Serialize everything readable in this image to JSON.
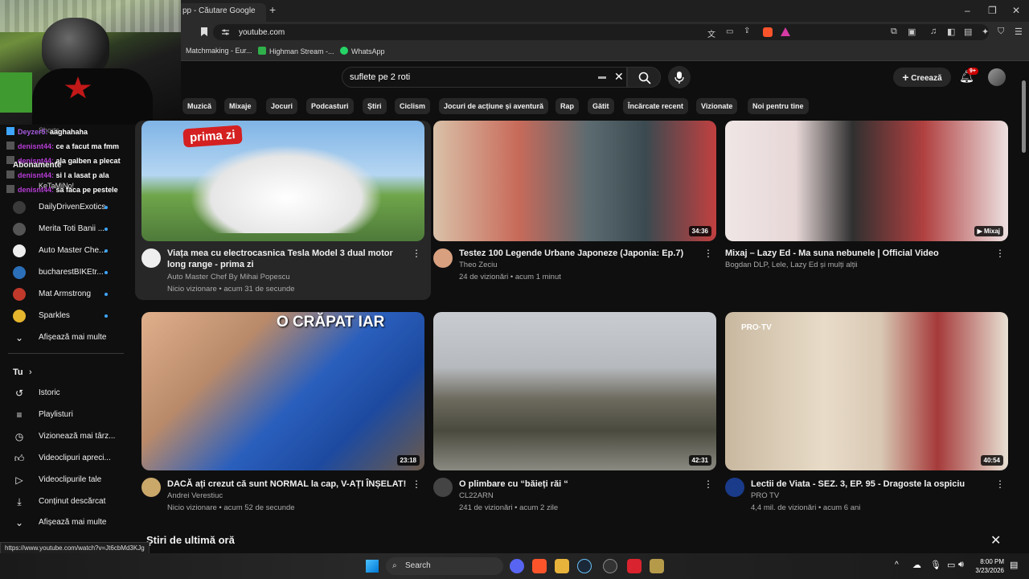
{
  "browser": {
    "tab_title": "pp - Căutare Google",
    "new_tab": "+",
    "url": "youtube.com",
    "bookmarks": [
      "Matchmaking - Eur...",
      "Highman Stream -...",
      "WhatsApp"
    ],
    "window_controls": [
      "–",
      "❐",
      "✕"
    ]
  },
  "youtube": {
    "search_query": "suflete pe 2 roti",
    "create_label": "Creează",
    "notif_badge": "9+",
    "chips": [
      "Muzică",
      "Mixaje",
      "Jocuri",
      "Podcasturi",
      "Știri",
      "Ciclism",
      "Jocuri de acțiune și aventură",
      "Rap",
      "Gătit",
      "Încărcate recent",
      "Vizionate",
      "Noi pentru tine"
    ]
  },
  "chat": [
    {
      "user": "Deyzer5:",
      "msg": "aaghahaha"
    },
    {
      "user": "denisnt44:",
      "msg": "ce a facut ma fmm"
    },
    {
      "user": "denisnt44:",
      "msg": "ala galben a plecat"
    },
    {
      "user": "denisnt44:",
      "msg": "si l a lasat p ala"
    },
    {
      "user": "denisnt44:",
      "msg": "sa faca pe pestele"
    }
  ],
  "chat_overlap": {
    "shorts": "Shorts",
    "abonamente": "Abonamente",
    "ketamino": "KeTaMiNo!"
  },
  "sidebar": {
    "subscriptions": [
      {
        "label": "DailyDrivenExotics",
        "color": "#3a3a3a"
      },
      {
        "label": "Merita Toti Banii ...",
        "color": "#555"
      },
      {
        "label": "Auto Master Che...",
        "color": "#eeeeee"
      },
      {
        "label": "bucharestBIKEtr...",
        "color": "#2b6fb8"
      },
      {
        "label": "Mat Armstrong",
        "color": "#c0392b"
      },
      {
        "label": "Sparkles",
        "color": "#e5b52e"
      }
    ],
    "show_more_1": "Afișează mai multe",
    "you_heading": "Tu",
    "you_items": [
      {
        "label": "Istoric",
        "icon": "history-icon"
      },
      {
        "label": "Playlisturi",
        "icon": "playlist-icon"
      },
      {
        "label": "Vizionează mai târz...",
        "icon": "watch-later-icon"
      },
      {
        "label": "Videoclipuri apreci...",
        "icon": "like-icon"
      },
      {
        "label": "Videoclipurile tale",
        "icon": "your-videos-icon"
      },
      {
        "label": "Conținut descărcat",
        "icon": "download-icon"
      }
    ],
    "show_more_2": "Afișează mai multe"
  },
  "videos": [
    {
      "thumb_text": "prima zi",
      "duration": "",
      "title": "Viața mea cu electrocasnica Tesla Model 3 dual motor long range - prima zi",
      "channel": "Auto Master Chef By Mihai Popescu",
      "meta": "Nicio vizionare • acum 31 de secunde",
      "avatar": "#eeeeee"
    },
    {
      "thumb_text": "",
      "duration": "34:36",
      "title": "Testez 100 Legende Urbane Japoneze (Japonia: Ep.7)",
      "channel": "Theo Zeciu",
      "meta": "24 de vizionări • acum 1 minut",
      "avatar": "#d9a080"
    },
    {
      "thumb_text": "",
      "duration": "Mixaj",
      "title": "Mixaj – Lazy Ed - Ma suna nebunele | Official Video",
      "channel": "Bogdan DLP, Lele, Lazy Ed și mulți alții",
      "meta": "",
      "avatar": ""
    },
    {
      "thumb_text": "O CRĂPAT IAR",
      "duration": "23:18",
      "title": "DACĂ ați crezut că sunt NORMAL la cap, V-AȚI ÎNȘELAT!",
      "channel": "Andrei Verestiuc",
      "meta": "Nicio vizionare • acum 52 de secunde",
      "avatar": "#caa86a"
    },
    {
      "thumb_text": "",
      "duration": "42:31",
      "title": "O plimbare cu “băieți răi “",
      "channel": "CL22ARN",
      "meta": "241 de vizionări • acum 2 zile",
      "avatar": "#444"
    },
    {
      "thumb_text": "PRO·TV",
      "duration": "40:54",
      "title": "Lectii de Viata - SEZ. 3, EP. 95 - Dragoste la ospiciu",
      "channel": "PRO TV",
      "meta": "4,4 mil. de vizionări • acum 6 ani",
      "avatar": "#1a3a8a"
    }
  ],
  "news_heading": "Știri de ultimă oră",
  "status_url": "https://www.youtube.com/watch?v=Jt6cbMd3KJg",
  "taskbar": {
    "search": "Search",
    "time": "8:00 PM",
    "date": "3/23/2026"
  }
}
